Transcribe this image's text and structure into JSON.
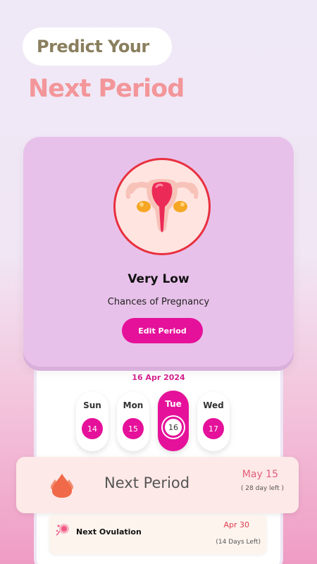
{
  "headline": {
    "top": "Predict Your",
    "main": "Next Period"
  },
  "status_card": {
    "illustration": "uterus-illustration",
    "title": "Very Low",
    "subtitle": "Chances of Pregnancy",
    "edit_button": "Edit Period"
  },
  "calendar": {
    "date": "16 Apr 2024",
    "days": [
      {
        "name": "Sun",
        "num": "14"
      },
      {
        "name": "Mon",
        "num": "15"
      },
      {
        "name": "Tue",
        "num": "16"
      },
      {
        "name": "Wed",
        "num": "17"
      }
    ],
    "selected_day": "Tue"
  },
  "next_period": {
    "icon": "blood-drops-icon",
    "title": "Next Period",
    "date": "May 15",
    "days_left": "( 28 day left )"
  },
  "ovulation": {
    "icon": "ovulation-icon",
    "title": "Next Ovulation",
    "date": "Apr 30",
    "days_left": "(14 Days Left)"
  },
  "colors": {
    "accent": "#e5119a",
    "headline_main": "#f3969a",
    "headline_top": "#8a7f5e",
    "card": "#e8c1ea"
  }
}
